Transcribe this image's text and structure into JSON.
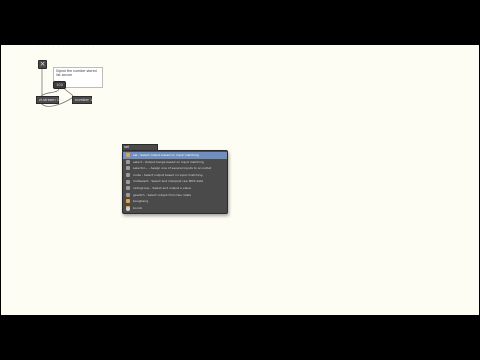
{
  "patcher": {
    "button_glyph": "×",
    "comment_text": "Signal the number stored list accum",
    "message_text": "100",
    "object_left": "zl.stream 100",
    "object_right": "number 1",
    "new_object_text": "sel"
  },
  "dropdown": {
    "items": [
      {
        "icon": "orange",
        "text": "sel - Select output based on input matching"
      },
      {
        "icon": "grey",
        "text": "select - Output bangs based on input matching"
      },
      {
        "icon": "grey",
        "text": "selector~ - Assign one of several inputs to an outlet"
      },
      {
        "icon": "grey",
        "text": "route - Select output based on input matching"
      },
      {
        "icon": "grey",
        "text": "midiselect - Select and interpret raw MIDI data"
      },
      {
        "icon": "grey",
        "text": "radiogroup - Select and output a value"
      },
      {
        "icon": "grey",
        "text": "gswitch - Select output from two inlets"
      },
      {
        "icon": "orange",
        "text": "bangbang"
      },
      {
        "icon": "orange",
        "text": "bondo"
      }
    ],
    "selected_index": 0
  },
  "colors": {
    "canvas": "#fdfdf3",
    "object": "#4b4b4b",
    "selection": "#6e8fbf",
    "icon_orange": "#e8a23a"
  }
}
